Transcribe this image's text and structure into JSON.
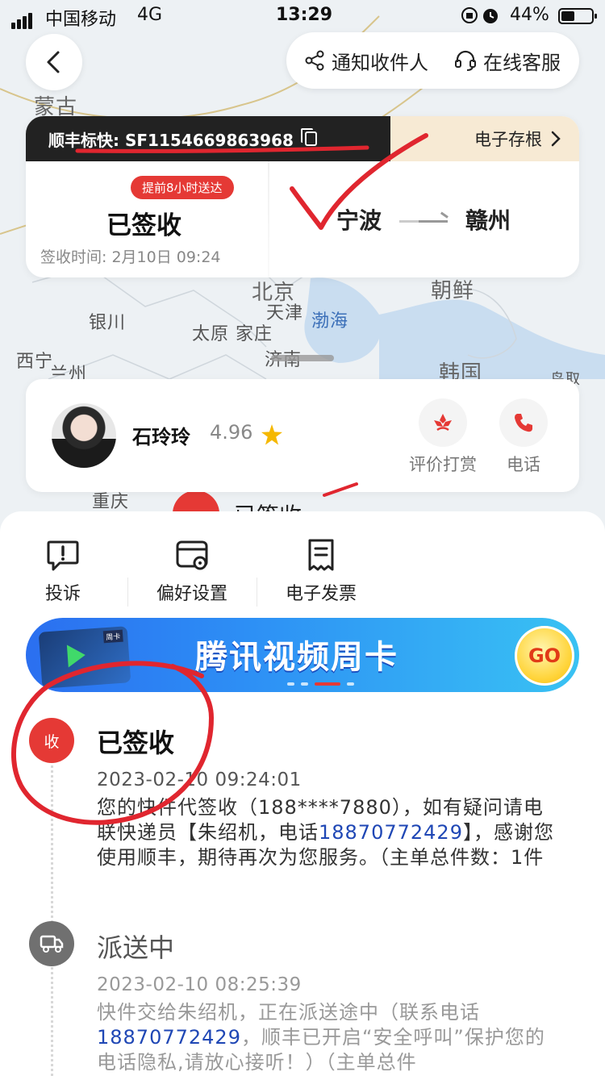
{
  "status_bar": {
    "carrier": "中国移动",
    "network": "4G",
    "time": "13:29",
    "battery": "44%"
  },
  "top": {
    "notify_label": "通知收件人",
    "service_label": "在线客服"
  },
  "map": {
    "labels": [
      "蒙古",
      "北京",
      "天津",
      "渤海",
      "银川",
      "太原",
      "家庄",
      "西宁",
      "兰州",
      "济南",
      "朝鲜",
      "韩国",
      "重庆",
      "鸟取"
    ]
  },
  "waybill": {
    "number": "顺丰标快: SF1154669863968",
    "stub_label": "电子存根",
    "advance_badge": "提前8小时送达",
    "status": "已签收",
    "sign_time": "签收时间: 2月10日 09:24",
    "from_city": "宁波",
    "to_city": "赣州"
  },
  "courier": {
    "name": "石玲玲",
    "rating": "4.96",
    "reward_label": "评价打赏",
    "phone_label": "电话",
    "peek_text": "已签收"
  },
  "tools": {
    "complaint": "投诉",
    "preference": "偏好设置",
    "invoice": "电子发票"
  },
  "banner": {
    "title": "腾讯视频周卡",
    "go": "GO",
    "card_tag": "周卡"
  },
  "timeline": [
    {
      "node": "收",
      "title": "已签收",
      "time": "2023-02-10 09:24:01",
      "desc_before": "您的快件代签收（188****7880），如有疑问请电联快递员【朱绍机，电话",
      "tel": "18870772429",
      "desc_after": "】，感谢您使用顺丰，期待再次为您服务。（主单总件数：1件"
    },
    {
      "title": "派送中",
      "time": "2023-02-10 08:25:39",
      "desc_before": "快件交给朱绍机，正在派送途中（联系电话",
      "tel": "18870772429",
      "desc_after": "，顺丰已开启“安全呼叫”保护您的电话隐私,请放心接听！）（主单总件"
    }
  ],
  "colors": {
    "brand_red": "#e53935",
    "banner_blue": "#2b6ff0",
    "annotation_red": "#e0262f"
  }
}
